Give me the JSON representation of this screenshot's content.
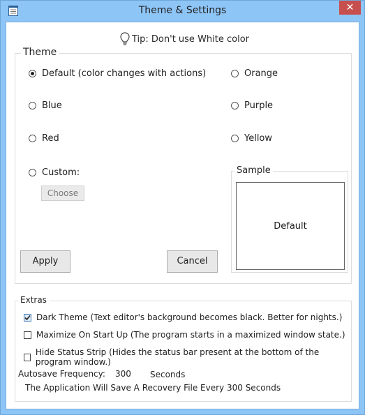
{
  "window": {
    "title": "Theme & Settings",
    "icons": {
      "app": "notepad-icon",
      "close": "close-icon"
    },
    "close_glyph": "✕"
  },
  "tip": {
    "text": "Tip: Don't use White color",
    "icon": "lightbulb-icon"
  },
  "theme": {
    "legend": "Theme",
    "options": [
      {
        "label": "Default (color changes with actions)",
        "checked": true
      },
      {
        "label": "Orange",
        "checked": false
      },
      {
        "label": "Blue",
        "checked": false
      },
      {
        "label": "Purple",
        "checked": false
      },
      {
        "label": "Red",
        "checked": false
      },
      {
        "label": "Yellow",
        "checked": false
      },
      {
        "label": "Custom:",
        "checked": false
      }
    ],
    "choose_label": "Choose",
    "sample": {
      "legend": "Sample",
      "preview_text": "Default"
    },
    "apply_label": "Apply",
    "cancel_label": "Cancel"
  },
  "extras": {
    "legend": "Extras",
    "checkboxes": [
      {
        "label": "Dark Theme (Text editor's background becomes black. Better for nights.)",
        "checked": true
      },
      {
        "label": "Maximize On Start Up (The program starts in a maximized window state.)",
        "checked": false
      },
      {
        "label": "Hide Status Strip (Hides the status bar present at the bottom of the program window.)",
        "checked": false
      }
    ],
    "autosave_label": "Autosave Frequency:",
    "autosave_value": "300",
    "autosave_unit": "Seconds",
    "autosave_note": "The Application Will Save A Recovery File Every 300 Seconds"
  }
}
